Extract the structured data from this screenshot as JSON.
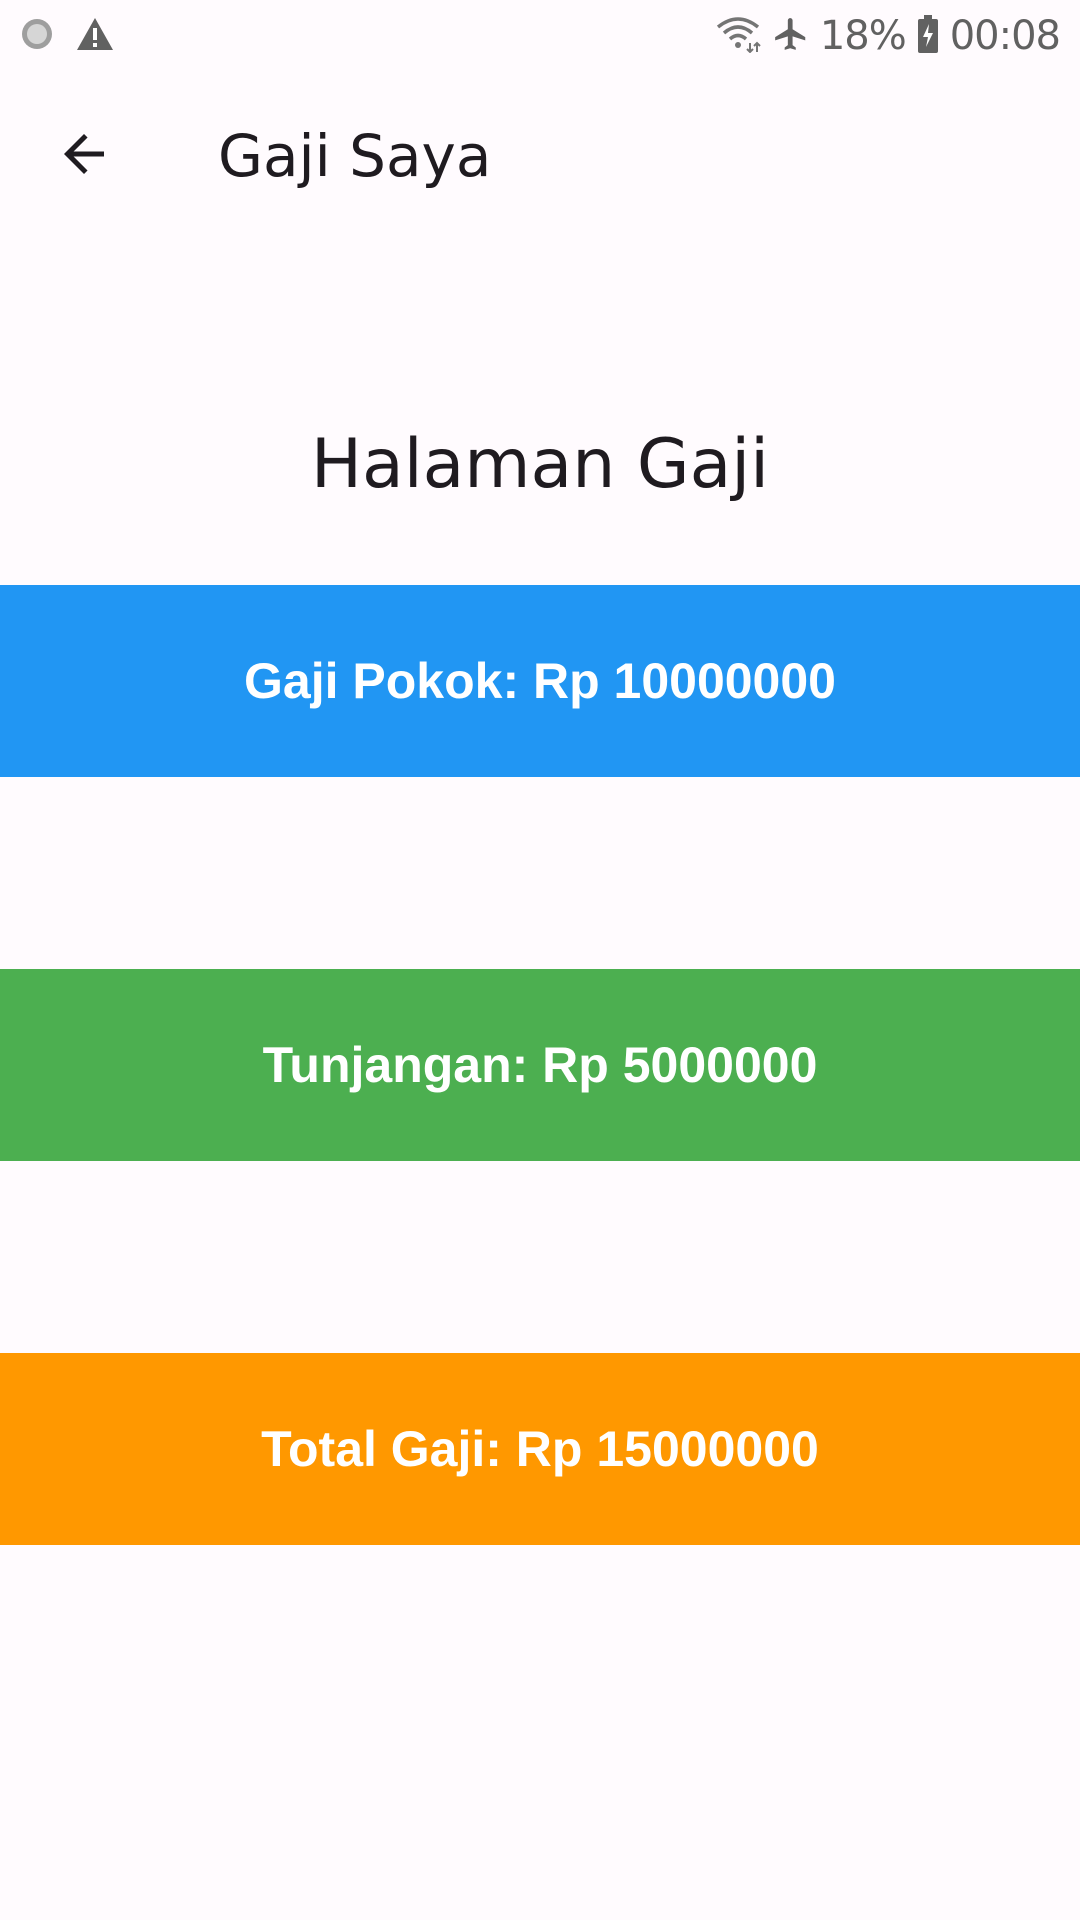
{
  "status_bar": {
    "battery_percent": "18%",
    "time": "00:08",
    "icons": [
      "sync-icon",
      "alert-icon",
      "wifi-icon",
      "airplane-icon",
      "battery-charging-icon"
    ]
  },
  "app_bar": {
    "title": "Gaji Saya",
    "back_icon": "arrow-back-icon"
  },
  "page": {
    "heading": "Halaman Gaji"
  },
  "salary_items": {
    "basic": {
      "text": "Gaji Pokok: Rp 10000000",
      "color": "#2196f3"
    },
    "allowance": {
      "text": "Tunjangan: Rp 5000000",
      "color": "#4caf50"
    },
    "total": {
      "text": "Total Gaji: Rp 15000000",
      "color": "#ff9800"
    }
  }
}
